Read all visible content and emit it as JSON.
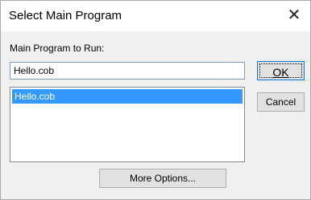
{
  "window": {
    "title": "Select Main Program",
    "close_glyph": "✕"
  },
  "main": {
    "label": "Main Program to Run:",
    "input_value": "Hello.cob",
    "list_items": [
      "Hello.cob"
    ],
    "selected_index": 0
  },
  "buttons": {
    "ok_label": "OK",
    "cancel_label": "Cancel",
    "more_options_label": "More Options..."
  },
  "colors": {
    "selection": "#3399ff",
    "focus_border": "#0078d7"
  }
}
